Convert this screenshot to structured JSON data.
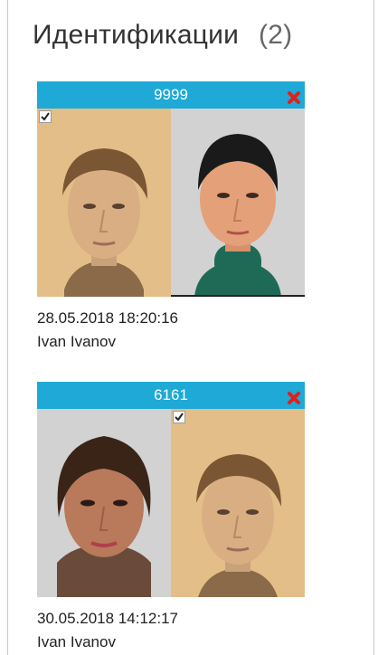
{
  "header": {
    "title": "Идентификации",
    "count": "(2)"
  },
  "cards": [
    {
      "id": "9999",
      "date": "28.05.2018 18:20:16",
      "name": "Ivan Ivanov",
      "checked_photo": "left",
      "left_photo": {
        "icon": "face-photo",
        "background": "#e3be88"
      },
      "right_photo": {
        "icon": "face-photo",
        "background": "#d2d2d2"
      }
    },
    {
      "id": "6161",
      "date": "30.05.2018 14:12:17",
      "name": "Ivan Ivanov",
      "checked_photo": "right",
      "left_photo": {
        "icon": "face-photo",
        "background": "#d2d2d2"
      },
      "right_photo": {
        "icon": "face-photo",
        "background": "#e3be88"
      }
    }
  ],
  "colors": {
    "header_bar": "#1ea9d6",
    "close_icon": "#e0201b"
  }
}
